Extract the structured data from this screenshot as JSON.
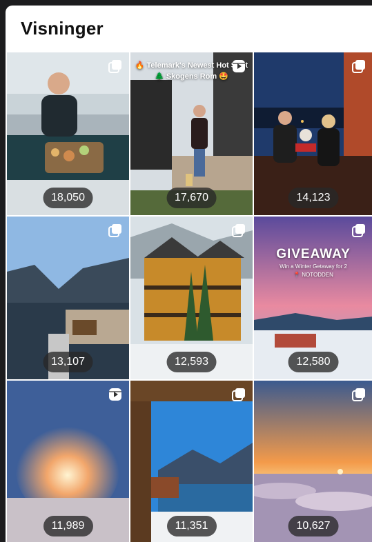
{
  "header": {
    "title": "Visninger"
  },
  "tiles": [
    {
      "views": "18,050",
      "type": "carousel",
      "icon": "carousel-icon",
      "colors": [
        "#7d8a94",
        "#2c3e44"
      ]
    },
    {
      "views": "17,670",
      "type": "reel",
      "icon": "reels-icon",
      "overlay_line1": "🔥 Telemark's Newest Hot Spot",
      "overlay_line2": "🌲 Skogens Rom 🤩",
      "colors": [
        "#c7ccd1",
        "#5b4a3c"
      ]
    },
    {
      "views": "14,123",
      "type": "carousel",
      "icon": "carousel-icon",
      "colors": [
        "#1f3a6b",
        "#3a2017"
      ]
    },
    {
      "views": "13,107",
      "type": "carousel",
      "icon": "carousel-icon",
      "colors": [
        "#8fb8e3",
        "#2a3a4a"
      ]
    },
    {
      "views": "12,593",
      "type": "carousel",
      "icon": "carousel-icon",
      "colors": [
        "#d9e1e6",
        "#6b4a1f"
      ]
    },
    {
      "views": "12,580",
      "type": "carousel",
      "icon": "carousel-icon",
      "overlay_title": "GIVEAWAY",
      "overlay_sub": "Win a Winter Getaway for 2",
      "overlay_tag": "📍 NOTODDEN",
      "colors": [
        "#6a4a9c",
        "#e98aa0"
      ]
    },
    {
      "views": "11,989",
      "type": "reel",
      "icon": "reels-icon",
      "colors": [
        "#3e5f99",
        "#f2a66b"
      ]
    },
    {
      "views": "11,351",
      "type": "carousel",
      "icon": "carousel-icon",
      "colors": [
        "#2e86d8",
        "#5b3a20"
      ]
    },
    {
      "views": "10,627",
      "type": "carousel",
      "icon": "carousel-icon",
      "colors": [
        "#3b5a8f",
        "#f39a4a"
      ]
    }
  ]
}
